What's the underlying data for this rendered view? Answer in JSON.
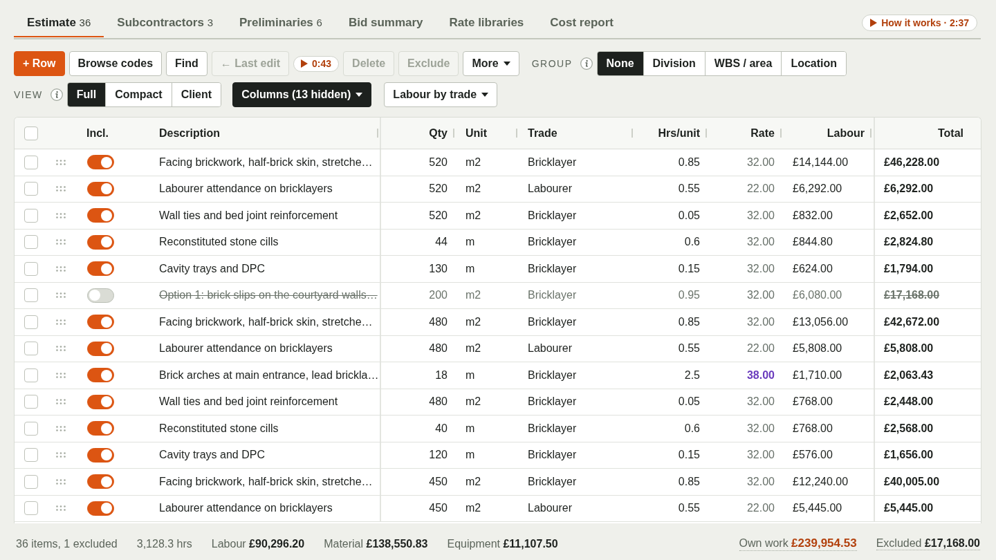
{
  "tabs": [
    {
      "label": "Estimate",
      "count": "36",
      "selected": true
    },
    {
      "label": "Subcontractors",
      "count": "3",
      "selected": false
    },
    {
      "label": "Preliminaries",
      "count": "6",
      "selected": false
    },
    {
      "label": "Bid summary",
      "selected": false
    },
    {
      "label": "Rate libraries",
      "selected": false
    },
    {
      "label": "Cost report",
      "selected": false
    }
  ],
  "help_button": {
    "label": "How it works · 2:37"
  },
  "toolbar": {
    "buttons": [
      {
        "kind": "primary",
        "label": "+ Row",
        "disabled": false
      },
      {
        "kind": "plain",
        "label": "Browse codes",
        "disabled": false
      },
      {
        "kind": "plain",
        "label": "Find",
        "disabled": false
      },
      {
        "kind": "plain",
        "label": "← Last edit",
        "disabled": true
      },
      {
        "kind": "timer",
        "label": "0:43",
        "disabled": false
      },
      {
        "kind": "plain",
        "label": "Delete",
        "disabled": true
      },
      {
        "kind": "plain",
        "label": "Exclude",
        "disabled": true
      },
      {
        "kind": "menu",
        "label": "More",
        "disabled": false
      }
    ],
    "group": {
      "label": "GROUP",
      "options": [
        {
          "label": "None",
          "selected": true
        },
        {
          "label": "Division",
          "selected": false
        },
        {
          "label": "WBS / area",
          "selected": false
        },
        {
          "label": "Location",
          "selected": false
        }
      ]
    }
  },
  "view_bar": {
    "view": {
      "label": "VIEW",
      "options": [
        {
          "label": "Full",
          "selected": true
        },
        {
          "label": "Compact",
          "selected": false
        },
        {
          "label": "Client",
          "selected": false
        }
      ]
    },
    "buttons": [
      {
        "kind": "dark_menu",
        "label": "Columns (13 hidden)",
        "disabled": false
      },
      {
        "kind": "menu",
        "label": "Labour by trade",
        "disabled": false
      }
    ]
  },
  "table": {
    "select_all": {
      "checked": false
    },
    "columns": [
      "Incl.",
      "Description",
      "Qty",
      "Unit",
      "Trade",
      "Hrs/unit",
      "Rate",
      "Labour",
      "Total"
    ],
    "rows": [
      {
        "selected": false,
        "included": true,
        "description": "Facing brickwork, half-brick skin, stretche…",
        "qty": "520",
        "unit": "m2",
        "trade": "Bricklayer",
        "hrs_per_unit": "0.85",
        "rate": "32.00",
        "rate_overridden": false,
        "labour": "£14,144.00",
        "total": "£46,228.00"
      },
      {
        "selected": false,
        "included": true,
        "description": "Labourer attendance on bricklayers",
        "qty": "520",
        "unit": "m2",
        "trade": "Labourer",
        "hrs_per_unit": "0.55",
        "rate": "22.00",
        "rate_overridden": false,
        "labour": "£6,292.00",
        "total": "£6,292.00"
      },
      {
        "selected": false,
        "included": true,
        "description": "Wall ties and bed joint reinforcement",
        "qty": "520",
        "unit": "m2",
        "trade": "Bricklayer",
        "hrs_per_unit": "0.05",
        "rate": "32.00",
        "rate_overridden": false,
        "labour": "£832.00",
        "total": "£2,652.00"
      },
      {
        "selected": false,
        "included": true,
        "description": "Reconstituted stone cills",
        "qty": "44",
        "unit": "m",
        "trade": "Bricklayer",
        "hrs_per_unit": "0.6",
        "rate": "32.00",
        "rate_overridden": false,
        "labour": "£844.80",
        "total": "£2,824.80"
      },
      {
        "selected": false,
        "included": true,
        "description": "Cavity trays and DPC",
        "qty": "130",
        "unit": "m",
        "trade": "Bricklayer",
        "hrs_per_unit": "0.15",
        "rate": "32.00",
        "rate_overridden": false,
        "labour": "£624.00",
        "total": "£1,794.00"
      },
      {
        "selected": false,
        "included": false,
        "description": "Option 1: brick slips on the courtyard walls…",
        "qty": "200",
        "unit": "m2",
        "trade": "Bricklayer",
        "hrs_per_unit": "0.95",
        "rate": "32.00",
        "rate_overridden": false,
        "labour": "£6,080.00",
        "total": "£17,168.00"
      },
      {
        "selected": false,
        "included": true,
        "description": "Facing brickwork, half-brick skin, stretche…",
        "qty": "480",
        "unit": "m2",
        "trade": "Bricklayer",
        "hrs_per_unit": "0.85",
        "rate": "32.00",
        "rate_overridden": false,
        "labour": "£13,056.00",
        "total": "£42,672.00"
      },
      {
        "selected": false,
        "included": true,
        "description": "Labourer attendance on bricklayers",
        "qty": "480",
        "unit": "m2",
        "trade": "Labourer",
        "hrs_per_unit": "0.55",
        "rate": "22.00",
        "rate_overridden": false,
        "labour": "£5,808.00",
        "total": "£5,808.00"
      },
      {
        "selected": false,
        "included": true,
        "description": "Brick arches at main entrance, lead brickla…",
        "qty": "18",
        "unit": "m",
        "trade": "Bricklayer",
        "hrs_per_unit": "2.5",
        "rate": "38.00",
        "rate_overridden": true,
        "labour": "£1,710.00",
        "total": "£2,063.43"
      },
      {
        "selected": false,
        "included": true,
        "description": "Wall ties and bed joint reinforcement",
        "qty": "480",
        "unit": "m2",
        "trade": "Bricklayer",
        "hrs_per_unit": "0.05",
        "rate": "32.00",
        "rate_overridden": false,
        "labour": "£768.00",
        "total": "£2,448.00"
      },
      {
        "selected": false,
        "included": true,
        "description": "Reconstituted stone cills",
        "qty": "40",
        "unit": "m",
        "trade": "Bricklayer",
        "hrs_per_unit": "0.6",
        "rate": "32.00",
        "rate_overridden": false,
        "labour": "£768.00",
        "total": "£2,568.00"
      },
      {
        "selected": false,
        "included": true,
        "description": "Cavity trays and DPC",
        "qty": "120",
        "unit": "m",
        "trade": "Bricklayer",
        "hrs_per_unit": "0.15",
        "rate": "32.00",
        "rate_overridden": false,
        "labour": "£576.00",
        "total": "£1,656.00"
      },
      {
        "selected": false,
        "included": true,
        "description": "Facing brickwork, half-brick skin, stretche…",
        "qty": "450",
        "unit": "m2",
        "trade": "Bricklayer",
        "hrs_per_unit": "0.85",
        "rate": "32.00",
        "rate_overridden": false,
        "labour": "£12,240.00",
        "total": "£40,005.00"
      },
      {
        "selected": false,
        "included": true,
        "description": "Labourer attendance on bricklayers",
        "qty": "450",
        "unit": "m2",
        "trade": "Labourer",
        "hrs_per_unit": "0.55",
        "rate": "22.00",
        "rate_overridden": false,
        "labour": "£5,445.00",
        "total": "£5,445.00"
      }
    ]
  },
  "status_bar": {
    "left": [
      {
        "text": "36 items, 1 excluded"
      },
      {
        "text": "3,128.3 hrs"
      },
      {
        "text": "Labour **£90,296.20**"
      },
      {
        "text": "Material **£138,550.83**"
      },
      {
        "text": "Equipment **£11,107.50**"
      }
    ],
    "right": [
      {
        "text": "Own work **£239,954.53**",
        "accent": true
      },
      {
        "text": "Excluded **£17,168.00**",
        "accent": false
      }
    ]
  }
}
